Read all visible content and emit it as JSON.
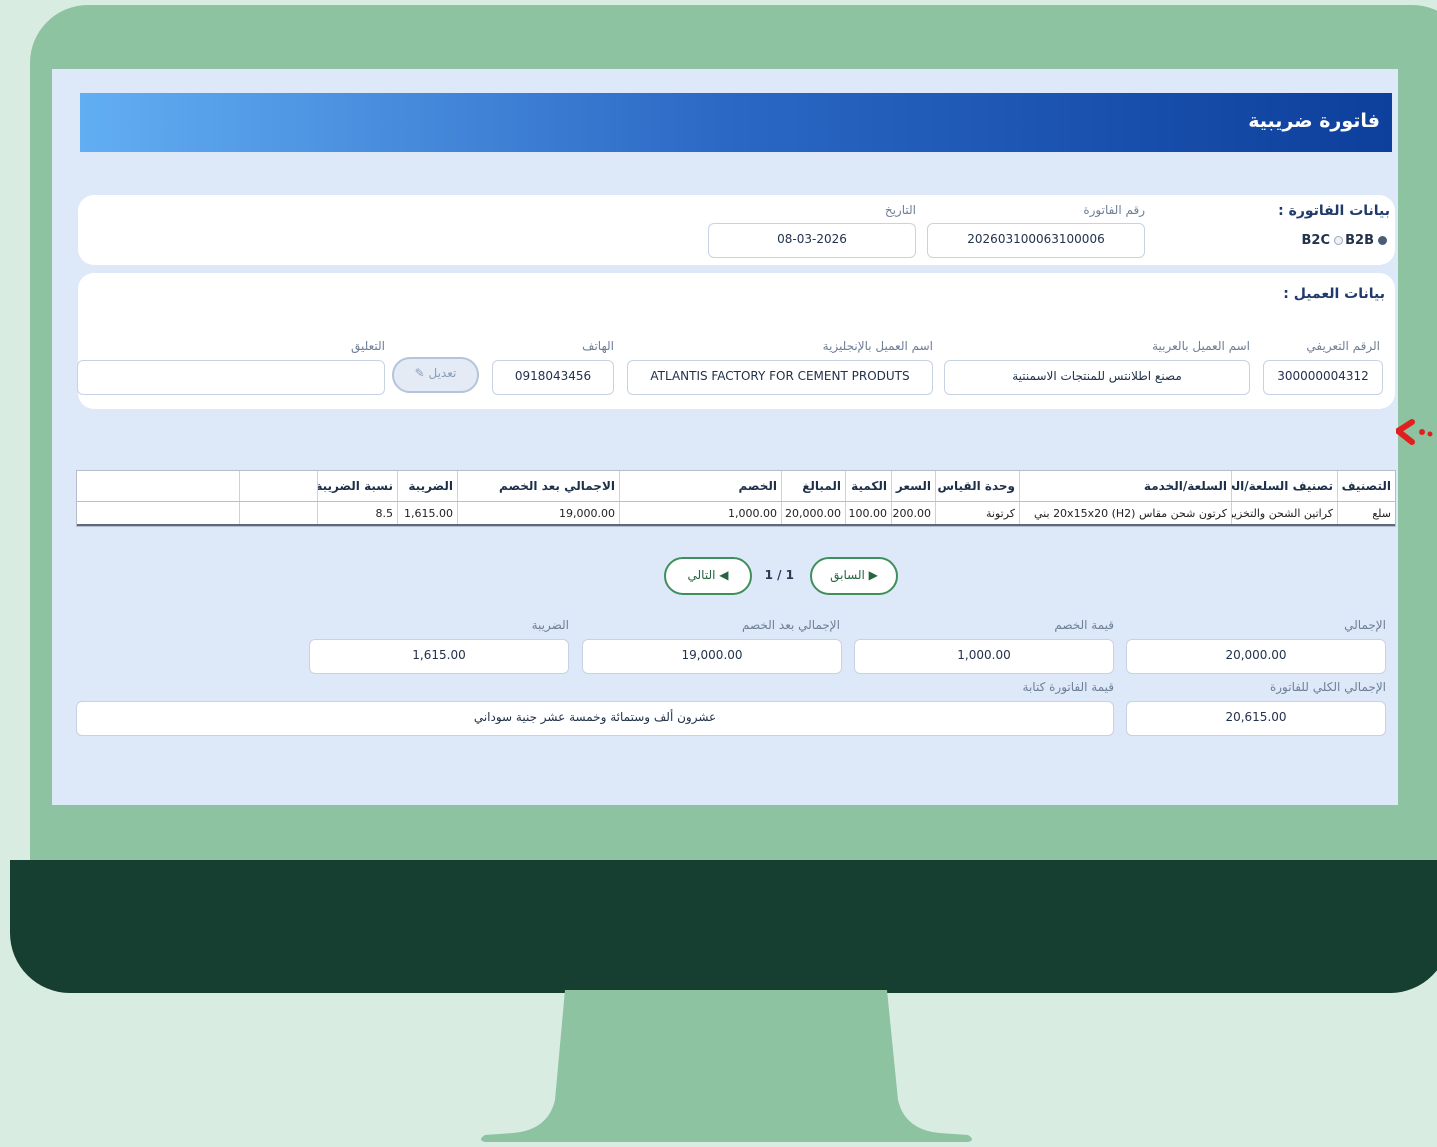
{
  "page": {
    "title": "فاتورة ضريبية"
  },
  "invoice": {
    "section_label": "بيانات الفاتورة :",
    "type_b2b": "B2B",
    "type_b2c": "B2C",
    "selected_type": "B2B",
    "number_label": "رقم الفاتورة",
    "number": "202603100063100006",
    "date_label": "التاريخ",
    "date": "08-03-2026"
  },
  "customer": {
    "section_label": "بيانات العميل :",
    "id_label": "الرقم التعريفي",
    "id": "300000004312",
    "name_ar_label": "اسم العميل بالعربية",
    "name_ar": "مصنع اطلانتس للمنتجات الاسمنتية",
    "name_en_label": "اسم العميل بالإنجليزية",
    "name_en": "ATLANTIS FACTORY FOR CEMENT PRODUTS",
    "phone_label": "الهاتف",
    "phone": "0918043456",
    "edit_label": "تعديل ✎",
    "comment_label": "التعليق",
    "comment": ""
  },
  "table": {
    "headers": [
      "التصنيف",
      "تصنيف السلعة/الخدمة",
      "السلعة/الخدمة",
      "وحدة القياس",
      "السعر",
      "الكمية",
      "المبالغ",
      "الخصم",
      "الاجمالي بعد الخصم",
      "الضريبة",
      "نسبة الضريبة",
      "",
      ""
    ],
    "rows": [
      [
        "سلع",
        "كراتين الشحن والتخزين",
        "كرتون شحن مقاس (H2) 20x15x20 بني",
        "كرتونة",
        "200.00",
        "100.00",
        "20,000.00",
        "1,000.00",
        "19,000.00",
        "1,615.00",
        "8.5",
        "",
        ""
      ]
    ]
  },
  "pager": {
    "prev_label": "▶ السابق",
    "next_label": "◀ التالي",
    "page_text": "1 / 1"
  },
  "totals": {
    "total_label": "الإجمالي",
    "total": "20,000.00",
    "discount_label": "قيمة الخصم",
    "discount": "1,000.00",
    "after_discount_label": "الإجمالي بعد الخصم",
    "after_discount": "19,000.00",
    "tax_label": "الضريبة",
    "tax": "1,615.00",
    "grand_total_label": "الإجمالي الكلي للفاتورة",
    "grand_total": "20,615.00",
    "in_words_label": "قيمة الفاتورة كتابة",
    "in_words": "عشرون ألف  وستمائة وخمسة عشر  جنية سوداني"
  },
  "colors": {
    "bezel": "#8dc3a0",
    "base": "#163f31",
    "background": "#d8ece1",
    "title_dark": "#0d3f9c",
    "title_light": "#62aef3",
    "pager_border": "#3f8f5d",
    "annotation": "#e0201f"
  }
}
